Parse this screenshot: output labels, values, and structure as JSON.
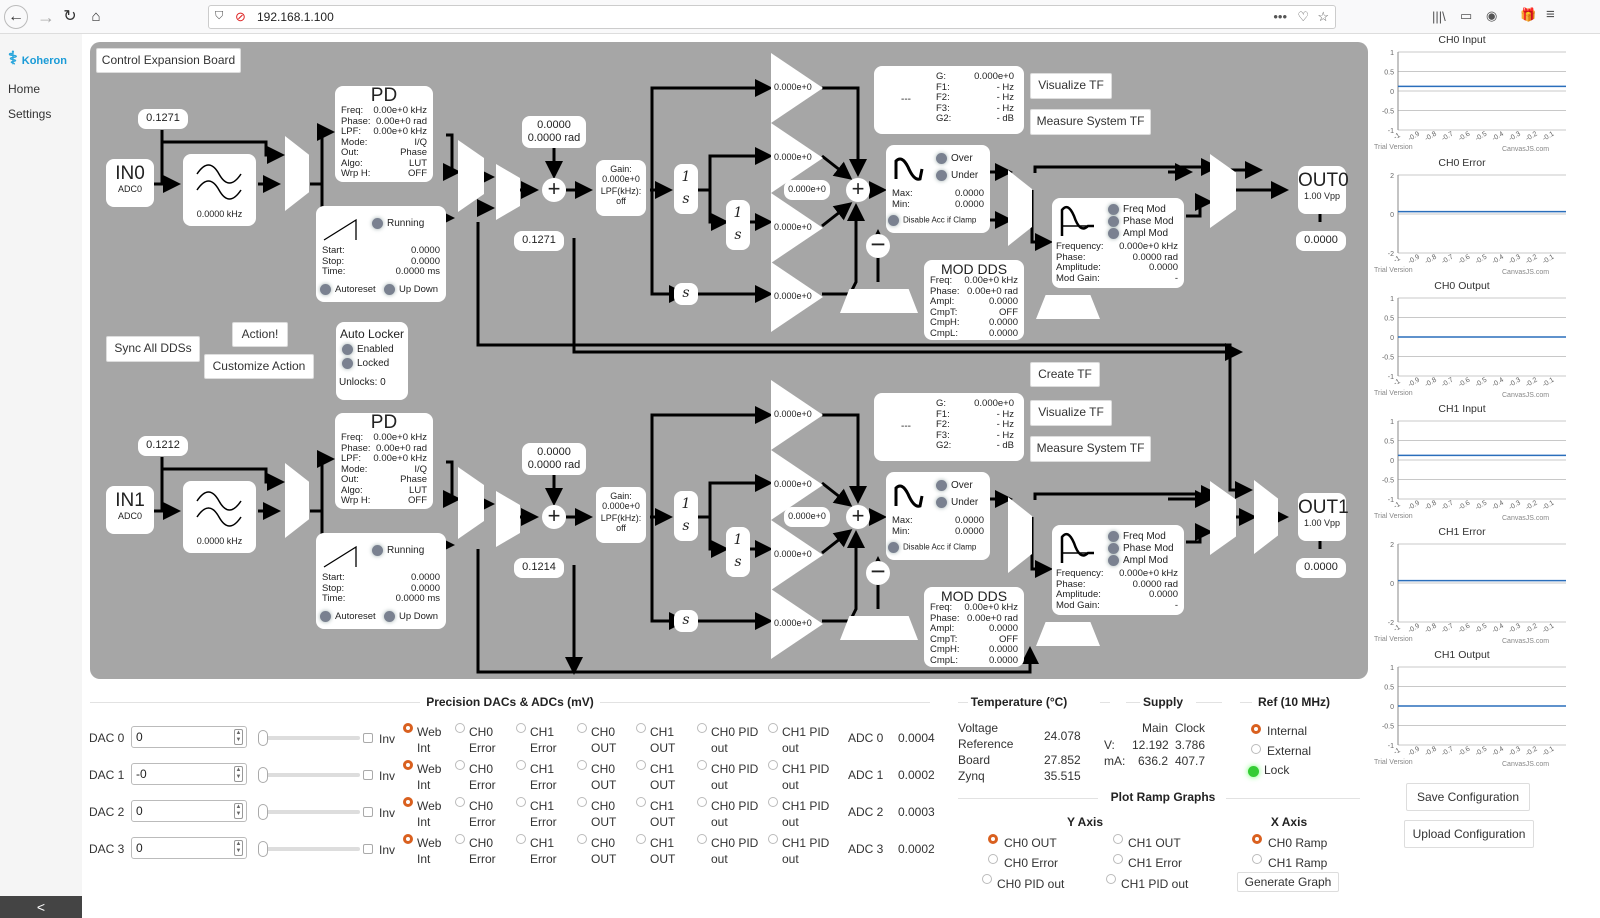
{
  "browser": {
    "url": "192.168.1.100",
    "menu_dots": "•••"
  },
  "sidebar": {
    "brand": "Koheron",
    "items": [
      {
        "label": "Home"
      },
      {
        "label": "Settings"
      }
    ],
    "collapse_label": "<"
  },
  "panel": {
    "title_button": "Control Expansion Board",
    "sync_button": "Sync All DDSs",
    "action_button": "Action!",
    "customize_button": "Customize Action",
    "create_tf_button": "Create TF",
    "auto_locker": {
      "title": "Auto Locker",
      "enabled_label": "Enabled",
      "locked_label": "Locked",
      "unlocks": "Unlocks: 0"
    },
    "channels": [
      {
        "input": {
          "name": "IN0",
          "source": "ADC0",
          "offset": "0.1271"
        },
        "filter_freq": "0.0000 kHz",
        "pd": {
          "title": "PD",
          "rows": [
            [
              "Freq:",
              "0.00e+0 kHz"
            ],
            [
              "Phase:",
              "0.00e+0 rad"
            ],
            [
              "LPF:",
              "0.00e+0 kHz"
            ],
            [
              "Mode:",
              "I/Q"
            ],
            [
              "Out:",
              "Phase"
            ],
            [
              "Algo:",
              "LUT"
            ],
            [
              "Wrp H:",
              "OFF"
            ]
          ]
        },
        "ramp": {
          "running_label": "Running",
          "rows": [
            [
              "Start:",
              "0.0000"
            ],
            [
              "Stop:",
              "0.0000"
            ],
            [
              "Time:",
              "0.0000 ms"
            ]
          ],
          "autoreset_label": "Autoreset",
          "updown_label": "Up Down"
        },
        "setpoint": {
          "value": "0.0000",
          "phase": "0.0000 rad"
        },
        "error_value": "0.1271",
        "gain_box": {
          "gain_label": "Gain:",
          "gain": "0.000e+0",
          "lpf_label": "LPF(kHz):",
          "lpf": "off"
        },
        "pid_gains": [
          "0.000e+0",
          "0.000e+0",
          "0.000e+0",
          "0.000e+0"
        ],
        "offset_gain": "0.000e+0",
        "tf": {
          "label": "---",
          "rows": [
            [
              "G:",
              "0.000e+0"
            ],
            [
              "F1:",
              "- Hz"
            ],
            [
              "F2:",
              "- Hz"
            ],
            [
              "F3:",
              "- Hz"
            ],
            [
              "G2:",
              "- dB"
            ]
          ],
          "visualize_button": "Visualize TF",
          "measure_button": "Measure System TF"
        },
        "clamp": {
          "over_label": "Over",
          "under_label": "Under",
          "rows": [
            [
              "Max:",
              "0.0000"
            ],
            [
              "Min:",
              "0.0000"
            ]
          ],
          "disable_label": "Disable Acc if Clamp"
        },
        "mod_dds": {
          "title": "MOD DDS",
          "rows": [
            [
              "Freq:",
              "0.00e+0 kHz"
            ],
            [
              "Phase:",
              "0.00e+0 rad"
            ],
            [
              "Ampl:",
              "0.0000"
            ],
            [
              "CmpT:",
              "OFF"
            ],
            [
              "CmpH:",
              "0.0000"
            ],
            [
              "CmpL:",
              "0.0000"
            ]
          ]
        },
        "dds": {
          "freq_mod": "Freq Mod",
          "phase_mod": "Phase Mod",
          "ampl_mod": "Ampl Mod",
          "rows": [
            [
              "Frequency:",
              "0.000e+0 kHz"
            ],
            [
              "Phase:",
              "0.0000 rad"
            ],
            [
              "Amplitude:",
              "0.0000"
            ],
            [
              "Mod Gain:",
              "-"
            ]
          ]
        },
        "output": {
          "name": "OUT0",
          "vpp": "1.00 Vpp",
          "value": "0.0000"
        }
      },
      {
        "input": {
          "name": "IN1",
          "source": "ADC0",
          "offset": "0.1212"
        },
        "filter_freq": "0.0000 kHz",
        "pd": {
          "title": "PD",
          "rows": [
            [
              "Freq:",
              "0.00e+0 kHz"
            ],
            [
              "Phase:",
              "0.00e+0 rad"
            ],
            [
              "LPF:",
              "0.00e+0 kHz"
            ],
            [
              "Mode:",
              "I/Q"
            ],
            [
              "Out:",
              "Phase"
            ],
            [
              "Algo:",
              "LUT"
            ],
            [
              "Wrp H:",
              "OFF"
            ]
          ]
        },
        "ramp": {
          "running_label": "Running",
          "rows": [
            [
              "Start:",
              "0.0000"
            ],
            [
              "Stop:",
              "0.0000"
            ],
            [
              "Time:",
              "0.0000 ms"
            ]
          ],
          "autoreset_label": "Autoreset",
          "updown_label": "Up Down"
        },
        "setpoint": {
          "value": "0.0000",
          "phase": "0.0000 rad"
        },
        "error_value": "0.1214",
        "gain_box": {
          "gain_label": "Gain:",
          "gain": "0.000e+0",
          "lpf_label": "LPF(kHz):",
          "lpf": "off"
        },
        "pid_gains": [
          "0.000e+0",
          "0.000e+0",
          "0.000e+0",
          "0.000e+0"
        ],
        "offset_gain": "0.000e+0",
        "tf": {
          "label": "---",
          "rows": [
            [
              "G:",
              "0.000e+0"
            ],
            [
              "F1:",
              "- Hz"
            ],
            [
              "F2:",
              "- Hz"
            ],
            [
              "F3:",
              "- Hz"
            ],
            [
              "G2:",
              "- dB"
            ]
          ],
          "visualize_button": "Visualize TF",
          "measure_button": "Measure System TF"
        },
        "clamp": {
          "over_label": "Over",
          "under_label": "Under",
          "rows": [
            [
              "Max:",
              "0.0000"
            ],
            [
              "Min:",
              "0.0000"
            ]
          ],
          "disable_label": "Disable Acc if Clamp"
        },
        "mod_dds": {
          "title": "MOD DDS",
          "rows": [
            [
              "Freq:",
              "0.00e+0 kHz"
            ],
            [
              "Phase:",
              "0.00e+0 rad"
            ],
            [
              "Ampl:",
              "0.0000"
            ],
            [
              "CmpT:",
              "OFF"
            ],
            [
              "CmpH:",
              "0.0000"
            ],
            [
              "CmpL:",
              "0.0000"
            ]
          ]
        },
        "dds": {
          "freq_mod": "Freq Mod",
          "phase_mod": "Phase Mod",
          "ampl_mod": "Ampl Mod",
          "rows": [
            [
              "Frequency:",
              "0.000e+0 kHz"
            ],
            [
              "Phase:",
              "0.0000 rad"
            ],
            [
              "Amplitude:",
              "0.0000"
            ],
            [
              "Mod Gain:",
              "-"
            ]
          ]
        },
        "output": {
          "name": "OUT1",
          "vpp": "1.00 Vpp",
          "value": "0.0000"
        }
      }
    ]
  },
  "precision": {
    "title": "Precision DACs & ADCs (mV)",
    "inv_label": "Inv",
    "source_options": [
      [
        "Web",
        "Int"
      ],
      [
        "CH0",
        "Error"
      ],
      [
        "CH1",
        "Error"
      ],
      [
        "CH0",
        "OUT"
      ],
      [
        "CH1",
        "OUT"
      ],
      [
        "CH0 PID",
        "out"
      ],
      [
        "CH1 PID",
        "out"
      ]
    ],
    "dacs": [
      {
        "label": "DAC 0",
        "value": "0",
        "inverted": false,
        "selected_source": 0
      },
      {
        "label": "DAC 1",
        "value": "-0",
        "inverted": false,
        "selected_source": 0
      },
      {
        "label": "DAC 2",
        "value": "0",
        "inverted": false,
        "selected_source": 0
      },
      {
        "label": "DAC 3",
        "value": "0",
        "inverted": false,
        "selected_source": 0
      }
    ],
    "adcs": [
      {
        "label": "ADC 0",
        "value": "0.0004"
      },
      {
        "label": "ADC 1",
        "value": "0.0002"
      },
      {
        "label": "ADC 2",
        "value": "0.0003"
      },
      {
        "label": "ADC 3",
        "value": "0.0002"
      }
    ]
  },
  "temperature": {
    "title": "Temperature (°C)",
    "rows": [
      [
        "Voltage",
        ""
      ],
      [
        "Reference",
        "24.078"
      ],
      [
        "Board",
        "27.852"
      ],
      [
        "Zynq",
        "35.515"
      ]
    ]
  },
  "supply": {
    "title": "Supply",
    "headers": [
      "",
      "Main",
      "Clock"
    ],
    "rows": [
      [
        "V:",
        "12.192",
        "3.786"
      ],
      [
        "mA:",
        "636.2",
        "407.7"
      ]
    ]
  },
  "ref": {
    "title": "Ref (10 MHz)",
    "internal_label": "Internal",
    "external_label": "External",
    "lock_label": "Lock",
    "selected": "Internal"
  },
  "plot_ramp": {
    "title": "Plot Ramp Graphs",
    "y_axis_title": "Y Axis",
    "x_axis_title": "X Axis",
    "y_options": [
      "CH0 OUT",
      "CH1 OUT",
      "CH0 Error",
      "CH1 Error",
      "CH0 PID out",
      "CH1 PID out"
    ],
    "y_selected": "CH0 OUT",
    "x_options": [
      "CH0 Ramp",
      "CH1 Ramp"
    ],
    "x_selected": "CH0 Ramp",
    "generate_button": "Generate Graph"
  },
  "config": {
    "save_button": "Save Configuration",
    "upload_button": "Upload Configuration"
  },
  "chart_data": [
    {
      "type": "line",
      "title": "CH0 Input",
      "ylim": [
        -1,
        1
      ],
      "yticks": [
        "1",
        "0.5",
        "0",
        "-0.5",
        "-1"
      ],
      "xticks": [
        "-1",
        "-0.9",
        "-0.8",
        "-0.7",
        "-0.6",
        "-0.5",
        "-0.4",
        "-0.3",
        "-0.2",
        "-0.1"
      ],
      "series": [
        {
          "name": "CH0 Input",
          "x": [
            -1,
            0
          ],
          "y": [
            0.12,
            0.12
          ]
        }
      ],
      "watermark": [
        "Trial Version",
        "CanvasJS.com"
      ]
    },
    {
      "type": "line",
      "title": "CH0 Error",
      "ylim": [
        -2,
        2
      ],
      "yticks": [
        "2",
        "0",
        "-2"
      ],
      "xticks": [
        "-1",
        "-0.9",
        "-0.8",
        "-0.7",
        "-0.6",
        "-0.5",
        "-0.4",
        "-0.3",
        "-0.2",
        "-0.1"
      ],
      "series": [
        {
          "name": "CH0 Error",
          "x": [
            -1,
            0
          ],
          "y": [
            0.12,
            0.12
          ]
        }
      ],
      "watermark": [
        "Trial Version",
        "CanvasJS.com"
      ]
    },
    {
      "type": "line",
      "title": "CH0 Output",
      "ylim": [
        -1,
        1
      ],
      "yticks": [
        "1",
        "0.5",
        "0",
        "-0.5",
        "-1"
      ],
      "xticks": [
        "-1",
        "-0.9",
        "-0.8",
        "-0.7",
        "-0.6",
        "-0.5",
        "-0.4",
        "-0.3",
        "-0.2",
        "-0.1"
      ],
      "series": [
        {
          "name": "CH0 Output",
          "x": [
            -1,
            0
          ],
          "y": [
            0,
            0
          ]
        }
      ],
      "watermark": [
        "Trial Version",
        "CanvasJS.com"
      ]
    },
    {
      "type": "line",
      "title": "CH1 Input",
      "ylim": [
        -1,
        1
      ],
      "yticks": [
        "1",
        "0.5",
        "0",
        "-0.5",
        "-1"
      ],
      "xticks": [
        "-1",
        "-0.9",
        "-0.8",
        "-0.7",
        "-0.6",
        "-0.5",
        "-0.4",
        "-0.3",
        "-0.2",
        "-0.1"
      ],
      "series": [
        {
          "name": "CH1 Input",
          "x": [
            -1,
            0
          ],
          "y": [
            0.12,
            0.12
          ]
        }
      ],
      "watermark": [
        "Trial Version",
        "CanvasJS.com"
      ]
    },
    {
      "type": "line",
      "title": "CH1 Error",
      "ylim": [
        -2,
        2
      ],
      "yticks": [
        "2",
        "0",
        "-2"
      ],
      "xticks": [
        "-1",
        "-0.9",
        "-0.8",
        "-0.7",
        "-0.6",
        "-0.5",
        "-0.4",
        "-0.3",
        "-0.2",
        "-0.1"
      ],
      "series": [
        {
          "name": "CH1 Error",
          "x": [
            -1,
            0
          ],
          "y": [
            0.12,
            0.12
          ]
        }
      ],
      "watermark": [
        "Trial Version",
        "CanvasJS.com"
      ]
    },
    {
      "type": "line",
      "title": "CH1 Output",
      "ylim": [
        -1,
        1
      ],
      "yticks": [
        "1",
        "0.5",
        "0",
        "-0.5",
        "-1"
      ],
      "xticks": [
        "-1",
        "-0.9",
        "-0.8",
        "-0.7",
        "-0.6",
        "-0.5",
        "-0.4",
        "-0.3",
        "-0.2",
        "-0.1"
      ],
      "series": [
        {
          "name": "CH1 Output",
          "x": [
            -1,
            0
          ],
          "y": [
            0,
            0
          ]
        }
      ],
      "watermark": [
        "Trial Version",
        "CanvasJS.com"
      ]
    }
  ]
}
